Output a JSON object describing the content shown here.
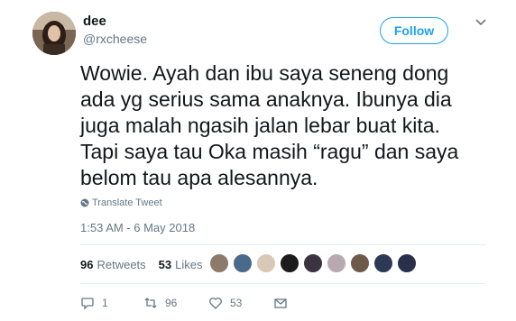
{
  "author": {
    "display_name": "dee",
    "handle": "@rxcheese",
    "avatar_icon": "profile-photo"
  },
  "header": {
    "follow_label": "Follow",
    "menu_icon": "chevron-down-icon"
  },
  "tweet": {
    "lines": [
      "Wowie. Ayah dan ibu saya seneng dong",
      "ada yg serius sama anaknya. Ibunya dia",
      "juga malah ngasih jalan lebar buat kita.",
      "Tapi saya tau Oka masih “ragu” dan saya",
      "belom tau apa alesannya."
    ],
    "translate_label": "Translate Tweet",
    "timestamp": "1:53 AM - 6 May 2018"
  },
  "stats": {
    "retweets_count": "96",
    "retweets_label": "Retweets",
    "likes_count": "53",
    "likes_label": "Likes"
  },
  "actions": {
    "reply_count": "1",
    "retweet_count": "96",
    "like_count": "53"
  },
  "colors": {
    "accent": "#1da1f2",
    "text": "#14171a",
    "muted": "#657786"
  }
}
